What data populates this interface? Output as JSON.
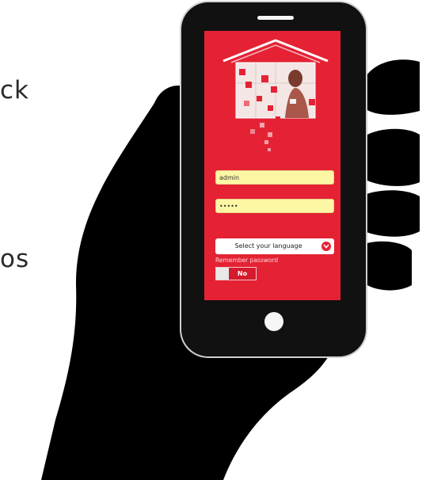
{
  "background": {
    "word_top": "ck",
    "word_bottom": "os"
  },
  "login": {
    "username_value": "admin",
    "password_value": "•••••",
    "language_label": "Select your language",
    "remember_label": "Remember password",
    "remember_toggle": "No"
  },
  "colors": {
    "screen_bg": "#e42234",
    "field_bg": "#fdf6a5",
    "phone_body": "#111111"
  },
  "icons": [
    "house-logo-icon",
    "chevron-down-icon",
    "home-button-icon"
  ]
}
